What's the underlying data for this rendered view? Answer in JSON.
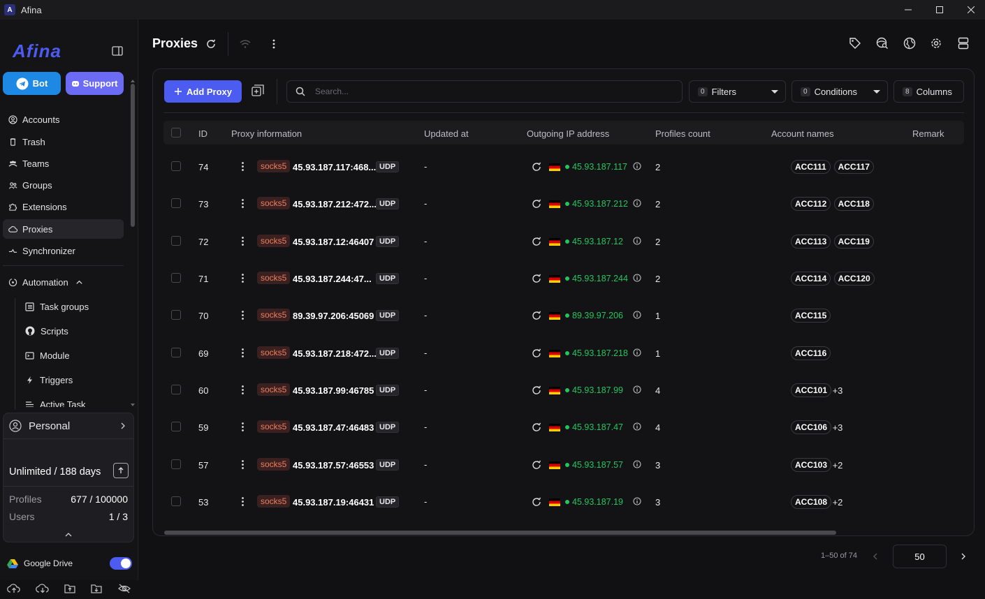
{
  "window": {
    "title": "Afina",
    "logo_letter": "A"
  },
  "sidebar": {
    "brand": "Afina",
    "bot_label": "Bot",
    "support_label": "Support",
    "nav": [
      "Accounts",
      "Trash",
      "Teams",
      "Groups",
      "Extensions",
      "Proxies",
      "Synchronizer"
    ],
    "active": "Proxies",
    "automation_label": "Automation",
    "automation_items": [
      "Task groups",
      "Scripts",
      "Module",
      "Triggers",
      "Active Task"
    ],
    "plan": {
      "workspace": "Personal",
      "license": "Unlimited / 188 days",
      "profiles_label": "Profiles",
      "profiles_value": "677 / 100000",
      "users_label": "Users",
      "users_value": "1 / 3"
    },
    "gdrive_label": "Google Drive",
    "gdrive_enabled": true
  },
  "header": {
    "title": "Proxies"
  },
  "toolbar": {
    "add_label": "Add Proxy",
    "search_placeholder": "Search...",
    "filters_count": "0",
    "filters_label": "Filters",
    "conditions_count": "0",
    "conditions_label": "Conditions",
    "columns_count": "8",
    "columns_label": "Columns"
  },
  "table": {
    "columns": [
      "ID",
      "Proxy information",
      "Updated at",
      "Outgoing IP address",
      "Profiles count",
      "Account names",
      "Remark"
    ],
    "rows": [
      {
        "id": "74",
        "type": "socks5",
        "proxy": "45.93.187.117:468...",
        "proto": "UDP",
        "updated": "-",
        "ip": "45.93.187.117",
        "count": "2",
        "accounts": [
          "ACC111",
          "ACC117"
        ],
        "more": ""
      },
      {
        "id": "73",
        "type": "socks5",
        "proxy": "45.93.187.212:472...",
        "proto": "UDP",
        "updated": "-",
        "ip": "45.93.187.212",
        "count": "2",
        "accounts": [
          "ACC112",
          "ACC118"
        ],
        "more": ""
      },
      {
        "id": "72",
        "type": "socks5",
        "proxy": "45.93.187.12:46407",
        "proto": "UDP",
        "updated": "-",
        "ip": "45.93.187.12",
        "count": "2",
        "accounts": [
          "ACC113",
          "ACC119"
        ],
        "more": ""
      },
      {
        "id": "71",
        "type": "socks5",
        "proxy": "45.93.187.244:47...",
        "proto": "UDP",
        "updated": "-",
        "ip": "45.93.187.244",
        "count": "2",
        "accounts": [
          "ACC114",
          "ACC120"
        ],
        "more": ""
      },
      {
        "id": "70",
        "type": "socks5",
        "proxy": "89.39.97.206:45069",
        "proto": "UDP",
        "updated": "-",
        "ip": "89.39.97.206",
        "count": "1",
        "accounts": [
          "ACC115"
        ],
        "more": ""
      },
      {
        "id": "69",
        "type": "socks5",
        "proxy": "45.93.187.218:472...",
        "proto": "UDP",
        "updated": "-",
        "ip": "45.93.187.218",
        "count": "1",
        "accounts": [
          "ACC116"
        ],
        "more": ""
      },
      {
        "id": "60",
        "type": "socks5",
        "proxy": "45.93.187.99:46785",
        "proto": "UDP",
        "updated": "-",
        "ip": "45.93.187.99",
        "count": "4",
        "accounts": [
          "ACC101"
        ],
        "more": "+3"
      },
      {
        "id": "59",
        "type": "socks5",
        "proxy": "45.93.187.47:46483",
        "proto": "UDP",
        "updated": "-",
        "ip": "45.93.187.47",
        "count": "4",
        "accounts": [
          "ACC106"
        ],
        "more": "+3"
      },
      {
        "id": "57",
        "type": "socks5",
        "proxy": "45.93.187.57:46553",
        "proto": "UDP",
        "updated": "-",
        "ip": "45.93.187.57",
        "count": "3",
        "accounts": [
          "ACC103"
        ],
        "more": "+2"
      },
      {
        "id": "53",
        "type": "socks5",
        "proxy": "45.93.187.19:46431",
        "proto": "UDP",
        "updated": "-",
        "ip": "45.93.187.19",
        "count": "3",
        "accounts": [
          "ACC108"
        ],
        "more": "+2"
      }
    ]
  },
  "pagination": {
    "range": "1–50 of 74",
    "page_size": "50"
  },
  "colors": {
    "accent": "#4c5cf0",
    "bot": "#1e88e5",
    "support": "#6b6bf5",
    "ip_green": "#22c55e",
    "socks": "#f07f5a"
  }
}
